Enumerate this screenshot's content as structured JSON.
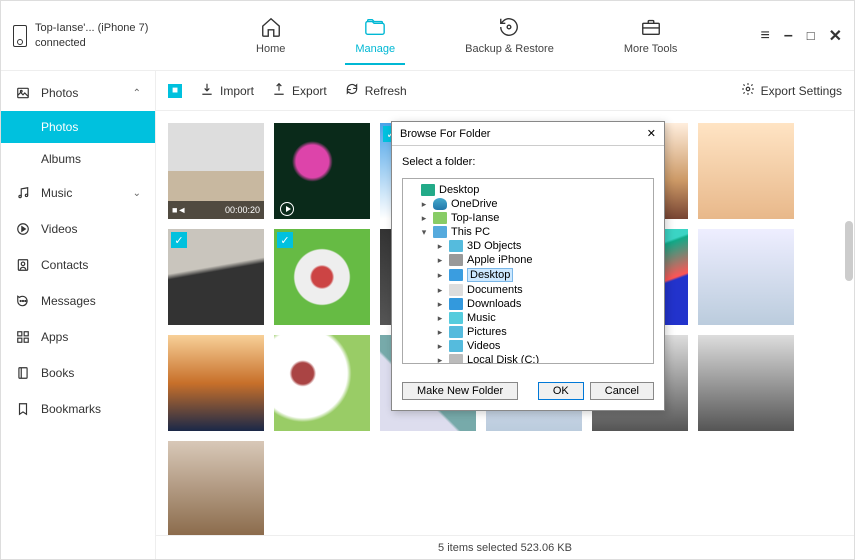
{
  "device": {
    "name": "Top-Ianse'... (iPhone 7)",
    "status": "connected"
  },
  "nav": {
    "home": "Home",
    "manage": "Manage",
    "backup": "Backup & Restore",
    "tools": "More Tools"
  },
  "sidebar": {
    "photos": "Photos",
    "photos_sub": "Photos",
    "albums": "Albums",
    "music": "Music",
    "videos": "Videos",
    "contacts": "Contacts",
    "messages": "Messages",
    "apps": "Apps",
    "books": "Books",
    "bookmarks": "Bookmarks"
  },
  "toolbar": {
    "import": "Import",
    "export": "Export",
    "refresh": "Refresh",
    "export_settings": "Export Settings"
  },
  "thumbs": {
    "video_duration": "00:00:20"
  },
  "status": "5 items selected 523.06 KB",
  "dialog": {
    "title": "Browse For Folder",
    "subtitle": "Select a folder:",
    "tree": {
      "desktop_root": "Desktop",
      "onedrive": "OneDrive",
      "user": "Top-Ianse",
      "this_pc": "This PC",
      "objects3d": "3D Objects",
      "apple_iphone": "Apple iPhone",
      "desktop": "Desktop",
      "documents": "Documents",
      "downloads": "Downloads",
      "music": "Music",
      "pictures": "Pictures",
      "videos": "Videos",
      "localdisk": "Local Disk (C:)"
    },
    "make_folder": "Make New Folder",
    "ok": "OK",
    "cancel": "Cancel"
  }
}
